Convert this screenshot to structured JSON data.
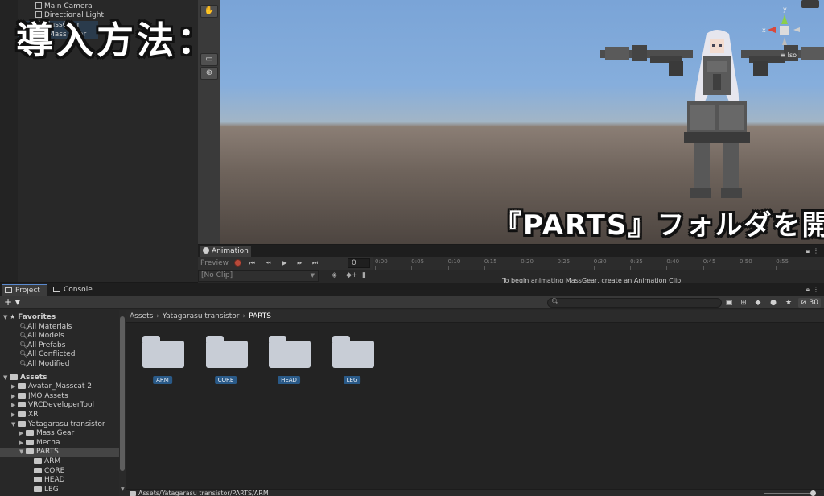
{
  "hierarchy": {
    "items": [
      {
        "label": "Main Camera"
      },
      {
        "label": "Directional Light"
      },
      {
        "label": "MassGear"
      },
      {
        "label": "Mass Gear"
      }
    ],
    "overlay_title": "導入方法：2"
  },
  "scene": {
    "gizmo_label": "Iso",
    "gizmo_axes": [
      "y",
      "x"
    ],
    "subtitle_overlay": "『PARTS』フォルダを開く",
    "sky_color": "#86aedc",
    "ground_color": "#6f645c"
  },
  "animation": {
    "tab_label": "Animation",
    "preview_label": "Preview",
    "frame_value": "0",
    "clip_label": "[No Clip]",
    "hint": "To begin animating MassGear, create an Animation Clip.",
    "ticks": [
      "0:00",
      "0:05",
      "0:10",
      "0:15",
      "0:20",
      "0:25",
      "0:30",
      "0:35",
      "0:40",
      "0:45",
      "0:50",
      "0:55"
    ]
  },
  "project": {
    "tabs": [
      {
        "label": "Project",
        "active": true
      },
      {
        "label": "Console",
        "active": false
      }
    ],
    "add_label": "+ ▾",
    "count_label": "30",
    "favorites": {
      "label": "Favorites",
      "items": [
        "All Materials",
        "All Models",
        "All Prefabs",
        "All Conflicted",
        "All Modified"
      ]
    },
    "assets": {
      "label": "Assets",
      "items": [
        {
          "label": "Avatar_Masscat 2",
          "depth": 1,
          "arrow": "▶"
        },
        {
          "label": "JMO Assets",
          "depth": 1,
          "arrow": "▶"
        },
        {
          "label": "VRCDeveloperTool",
          "depth": 1,
          "arrow": "▶"
        },
        {
          "label": "XR",
          "depth": 1,
          "arrow": "▶"
        },
        {
          "label": "Yatagarasu transistor",
          "depth": 1,
          "arrow": "▼"
        },
        {
          "label": "Mass Gear",
          "depth": 2,
          "arrow": "▶"
        },
        {
          "label": "Mecha",
          "depth": 2,
          "arrow": "▶"
        },
        {
          "label": "PARTS",
          "depth": 2,
          "arrow": "▼",
          "selected": true
        },
        {
          "label": "ARM",
          "depth": 3,
          "arrow": ""
        },
        {
          "label": "CORE",
          "depth": 3,
          "arrow": ""
        },
        {
          "label": "HEAD",
          "depth": 3,
          "arrow": ""
        },
        {
          "label": "LEG",
          "depth": 3,
          "arrow": ""
        }
      ]
    },
    "breadcrumb": [
      "Assets",
      "Yatagarasu transistor",
      "PARTS"
    ],
    "folders": [
      {
        "label": "ARM"
      },
      {
        "label": "CORE"
      },
      {
        "label": "HEAD"
      },
      {
        "label": "LEG"
      }
    ],
    "status_path": "Assets/Yatagarasu transistor/PARTS/ARM",
    "selection_color": "#2a5a88"
  }
}
